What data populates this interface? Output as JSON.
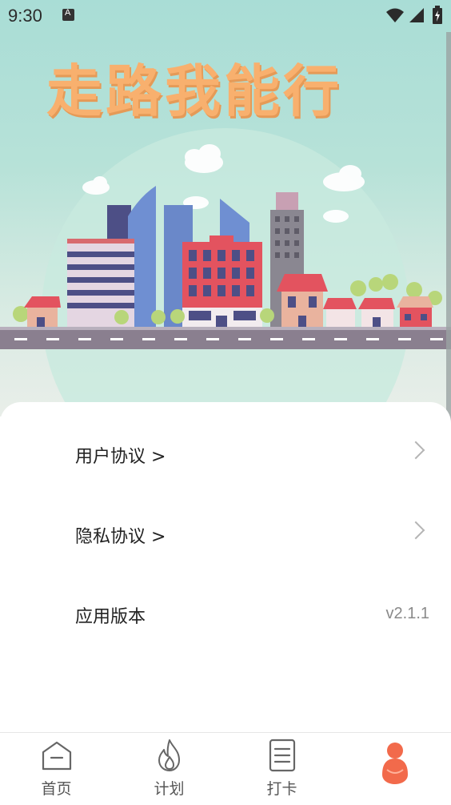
{
  "status_bar": {
    "time": "9:30"
  },
  "hero": {
    "title": "走路我能行"
  },
  "settings": {
    "items": [
      {
        "label": "用户协议 >",
        "has_chevron": true
      },
      {
        "label": "隐私协议 >",
        "has_chevron": true
      },
      {
        "label": "应用版本",
        "value": "v2.1.1"
      }
    ]
  },
  "bottom_nav": {
    "items": [
      {
        "label": "首页",
        "icon": "home-icon"
      },
      {
        "label": "计划",
        "icon": "flame-icon"
      },
      {
        "label": "打卡",
        "icon": "checklist-icon"
      },
      {
        "label": "",
        "icon": "profile-icon"
      }
    ],
    "active_color": "#f26a4b"
  }
}
